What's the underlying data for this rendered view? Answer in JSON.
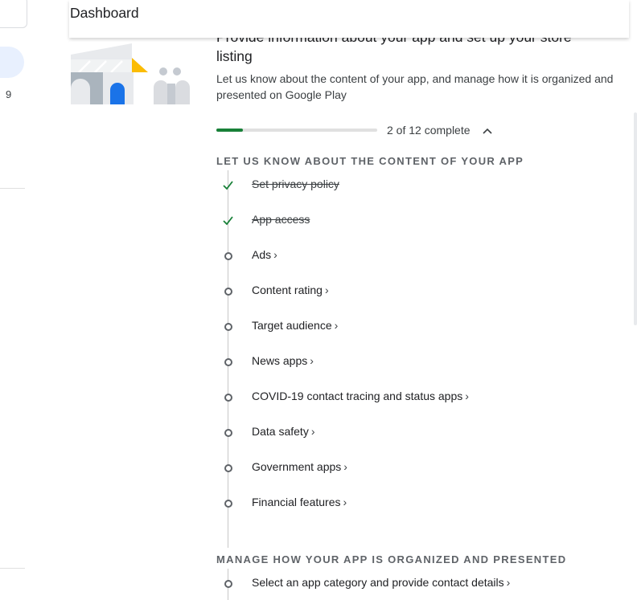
{
  "sidebar": {
    "badge_number": "9"
  },
  "appbar": {
    "title": "Dashboard"
  },
  "card": {
    "heading": "Provide information about your app and set up your store listing",
    "description": "Let us know about the content of your app, and manage how it is organized and presented on Google Play",
    "progress": {
      "completed": 2,
      "total": 12,
      "fraction": 0.1667,
      "text": "2 of 12 complete"
    }
  },
  "sections": {
    "content": {
      "title": "LET US KNOW ABOUT THE CONTENT OF YOUR APP",
      "tasks": [
        {
          "label": "Set privacy policy",
          "done": true
        },
        {
          "label": "App access",
          "done": true
        },
        {
          "label": "Ads",
          "done": false
        },
        {
          "label": "Content rating",
          "done": false
        },
        {
          "label": "Target audience",
          "done": false
        },
        {
          "label": "News apps",
          "done": false
        },
        {
          "label": "COVID-19 contact tracing and status apps",
          "done": false
        },
        {
          "label": "Data safety",
          "done": false
        },
        {
          "label": "Government apps",
          "done": false
        },
        {
          "label": "Financial features",
          "done": false
        }
      ]
    },
    "manage": {
      "title": "MANAGE HOW YOUR APP IS ORGANIZED AND PRESENTED",
      "tasks": [
        {
          "label": "Select an app category and provide contact details",
          "done": false
        }
      ]
    }
  },
  "colors": {
    "done_check": "#188038",
    "progress_fill": "#188038",
    "accent_blue": "#1a73e8"
  },
  "icons": {
    "done": "checkmark-icon",
    "pending": "circle-icon",
    "expand": "chevron-up-icon",
    "navigate": "chevron-right-icon"
  }
}
